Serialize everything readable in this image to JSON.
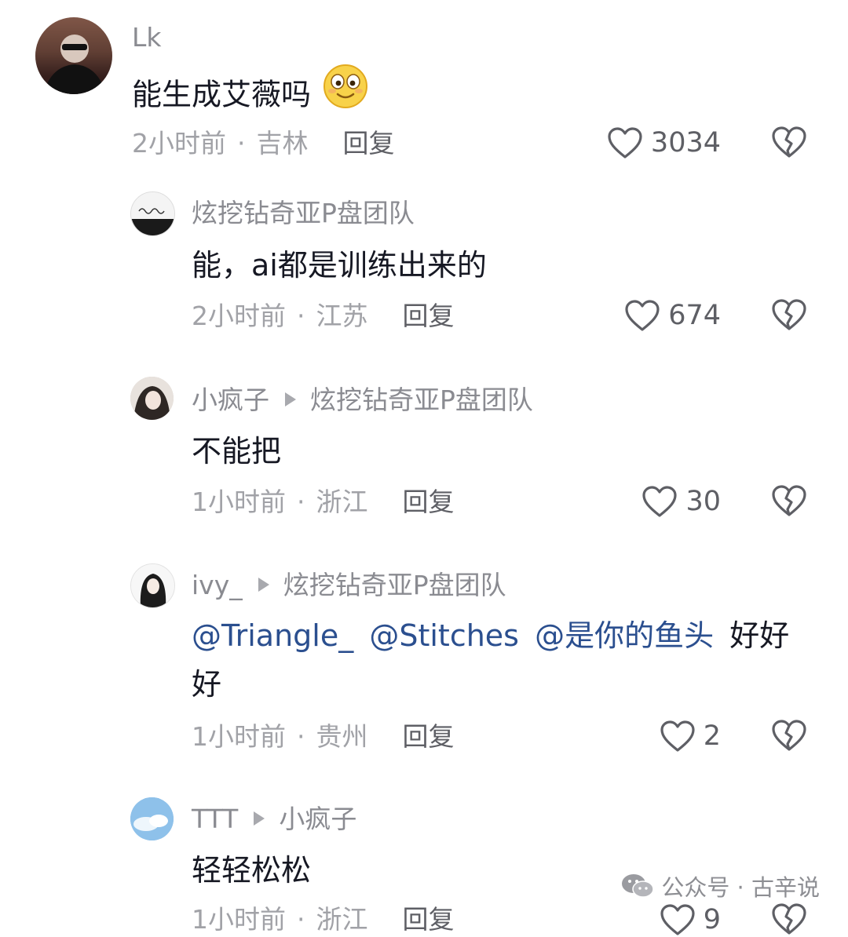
{
  "comments": [
    {
      "username": "Lk",
      "text": "能生成艾薇吗",
      "emoji": "smiling-face-emoji",
      "time": "2小时前",
      "location": "吉林",
      "reply_label": "回复",
      "likes": "3034"
    },
    {
      "username": "炫挖钻奇亚P盘团队",
      "text": "能，ai都是训练出来的",
      "time": "2小时前",
      "location": "江苏",
      "reply_label": "回复",
      "likes": "674"
    },
    {
      "username": "小疯子",
      "reply_to": "炫挖钻奇亚P盘团队",
      "text": "不能把",
      "time": "1小时前",
      "location": "浙江",
      "reply_label": "回复",
      "likes": "30"
    },
    {
      "username": "ivy_",
      "reply_to": "炫挖钻奇亚P盘团队",
      "mentions": [
        "@Triangle_",
        "@Stitches",
        "@是你的鱼头"
      ],
      "text_line1_suffix": "好好",
      "text_line2": "好",
      "time": "1小时前",
      "location": "贵州",
      "reply_label": "回复",
      "likes": "2"
    },
    {
      "username": "TTT",
      "reply_to": "小疯子",
      "text": "轻轻松松",
      "time": "1小时前",
      "location": "浙江",
      "reply_label": "回复",
      "likes": "9"
    }
  ],
  "watermark": {
    "icon": "wechat-icon",
    "text": "公众号 · 古辛说"
  },
  "colors": {
    "text": "#161823",
    "meta": "#a1a2a7",
    "mention": "#2b4f8f"
  }
}
